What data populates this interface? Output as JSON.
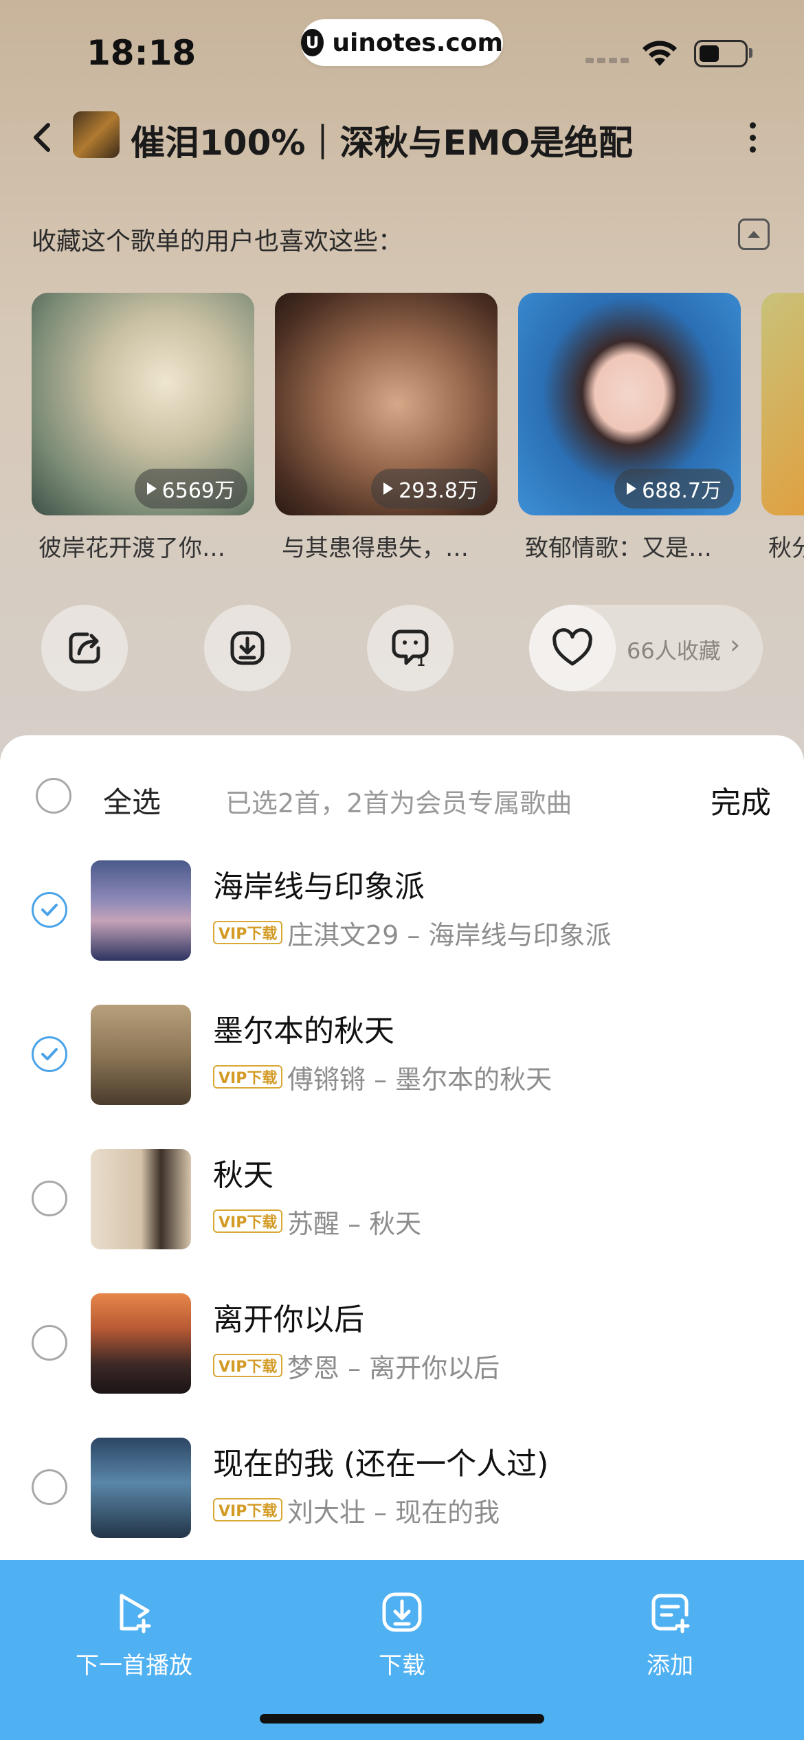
{
  "status_bar": {
    "time": "18:18",
    "brand": "uinotes.com",
    "brand_logo": "U"
  },
  "header": {
    "title": "催泪100%｜深秋与EMO是绝配"
  },
  "recommendations": {
    "heading": "收藏这个歌单的用户也喜欢这些：",
    "items": [
      {
        "plays": "6569万",
        "name": "彼岸花开渡了你…"
      },
      {
        "plays": "293.8万",
        "name": "与其患得患失，…"
      },
      {
        "plays": "688.7万",
        "name": "致郁情歌：又是…"
      },
      {
        "name": "秋分"
      }
    ]
  },
  "actions": {
    "favorites": "66人收藏"
  },
  "selection": {
    "select_all": "全选",
    "info": "已选2首，2首为会员专属歌曲",
    "done": "完成"
  },
  "songs": [
    {
      "title": "海岸线与印象派",
      "badge": "VIP下载",
      "meta": "庄淇文29 – 海岸线与印象派",
      "checked": true
    },
    {
      "title": "墨尔本的秋天",
      "badge": "VIP下载",
      "meta": "傅锵锵 – 墨尔本的秋天",
      "checked": true
    },
    {
      "title": "秋天",
      "badge": "VIP下载",
      "meta": "苏醒 – 秋天",
      "checked": false
    },
    {
      "title": "离开你以后",
      "badge": "VIP下载",
      "meta": "梦恩 – 离开你以后",
      "checked": false
    },
    {
      "title": "现在的我 (还在一个人过)",
      "badge": "VIP下载",
      "meta": "刘大壮 – 现在的我",
      "checked": false
    }
  ],
  "bottom_bar": {
    "play_next": "下一首播放",
    "download": "下载",
    "add": "添加"
  },
  "colors": {
    "accent": "#4fb0f2",
    "vip": "#d39b25",
    "check": "#4aa3e8"
  }
}
